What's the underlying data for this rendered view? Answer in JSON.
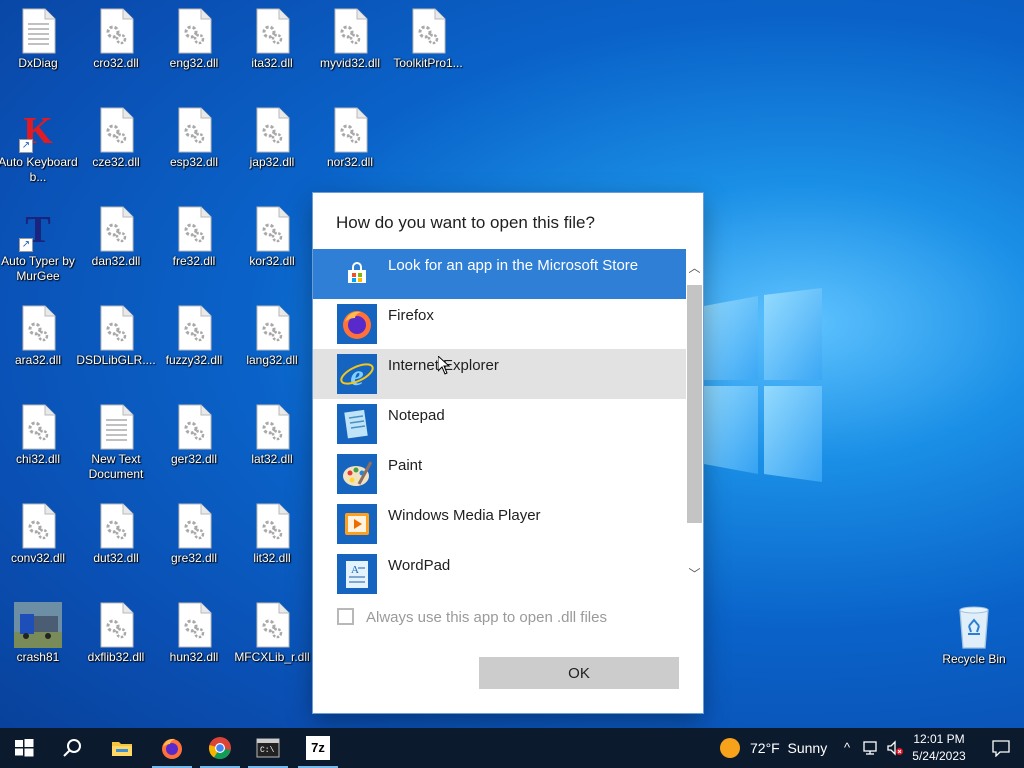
{
  "desktop": {
    "icons": [
      {
        "label": "DxDiag",
        "kind": "text-file"
      },
      {
        "label": "cro32.dll",
        "kind": "dll"
      },
      {
        "label": "eng32.dll",
        "kind": "dll"
      },
      {
        "label": "ita32.dll",
        "kind": "dll"
      },
      {
        "label": "myvid32.dll",
        "kind": "dll"
      },
      {
        "label": "ToolkitPro1...",
        "kind": "dll"
      },
      {
        "label": "Auto Keyboard b...",
        "kind": "k-app",
        "glyph": "K"
      },
      {
        "label": "cze32.dll",
        "kind": "dll"
      },
      {
        "label": "esp32.dll",
        "kind": "dll"
      },
      {
        "label": "jap32.dll",
        "kind": "dll"
      },
      {
        "label": "nor32.dll",
        "kind": "dll"
      },
      {
        "label": "Auto Typer by MurGee",
        "kind": "t-app",
        "glyph": "T"
      },
      {
        "label": "dan32.dll",
        "kind": "dll"
      },
      {
        "label": "fre32.dll",
        "kind": "dll"
      },
      {
        "label": "kor32.dll",
        "kind": "dll"
      },
      {
        "label": "ara32.dll",
        "kind": "dll"
      },
      {
        "label": "DSDLibGLR....",
        "kind": "dll"
      },
      {
        "label": "fuzzy32.dll",
        "kind": "dll"
      },
      {
        "label": "lang32.dll",
        "kind": "dll"
      },
      {
        "label": "chi32.dll",
        "kind": "dll"
      },
      {
        "label": "New Text Document",
        "kind": "text-file"
      },
      {
        "label": "ger32.dll",
        "kind": "dll"
      },
      {
        "label": "lat32.dll",
        "kind": "dll"
      },
      {
        "label": "conv32.dll",
        "kind": "dll"
      },
      {
        "label": "dut32.dll",
        "kind": "dll"
      },
      {
        "label": "gre32.dll",
        "kind": "dll"
      },
      {
        "label": "lit32.dll",
        "kind": "dll"
      },
      {
        "label": "crash81",
        "kind": "truck-image"
      },
      {
        "label": "dxflib32.dll",
        "kind": "dll"
      },
      {
        "label": "hun32.dll",
        "kind": "dll"
      },
      {
        "label": "MFCXLib_r.dll",
        "kind": "dll"
      },
      {
        "label": "Recycle Bin",
        "kind": "recycle-bin"
      }
    ]
  },
  "dialog": {
    "title": "How do you want to open this file?",
    "apps": [
      {
        "label": "Look for an app in the Microsoft Store",
        "icon": "store-icon",
        "state": "selected"
      },
      {
        "label": "Firefox",
        "icon": "firefox-icon",
        "state": "normal"
      },
      {
        "label": "Internet Explorer",
        "icon": "internet-explorer-icon",
        "state": "hover"
      },
      {
        "label": "Notepad",
        "icon": "notepad-icon",
        "state": "normal"
      },
      {
        "label": "Paint",
        "icon": "paint-icon",
        "state": "normal"
      },
      {
        "label": "Windows Media Player",
        "icon": "media-player-icon",
        "state": "normal"
      },
      {
        "label": "WordPad",
        "icon": "wordpad-icon",
        "state": "normal"
      }
    ],
    "scroll_up_glyph": "︿",
    "scroll_down_glyph": "﹀",
    "always_use_label": "Always use this app to open .dll files",
    "always_use_checked": false,
    "ok_label": "OK"
  },
  "taskbar": {
    "buttons": [
      {
        "name": "start-button",
        "icon": "windows-logo-icon"
      },
      {
        "name": "search-button",
        "icon": "search-icon"
      },
      {
        "name": "file-explorer-button",
        "icon": "folder-icon"
      },
      {
        "name": "firefox-taskbar-button",
        "icon": "firefox-icon"
      },
      {
        "name": "chrome-taskbar-button",
        "icon": "chrome-icon"
      },
      {
        "name": "terminal-taskbar-button",
        "icon": "terminal-icon"
      },
      {
        "name": "7zip-taskbar-button",
        "icon": "7zip-icon",
        "glyph": "7z"
      }
    ],
    "weather": {
      "temp": "72°F",
      "condition": "Sunny"
    },
    "tray": {
      "chevron": "^"
    },
    "clock": {
      "time": "12:01 PM",
      "date": "5/24/2023"
    },
    "colors": {
      "accent": "#2f7fd6",
      "taskbar": "#0c1a2e"
    }
  }
}
